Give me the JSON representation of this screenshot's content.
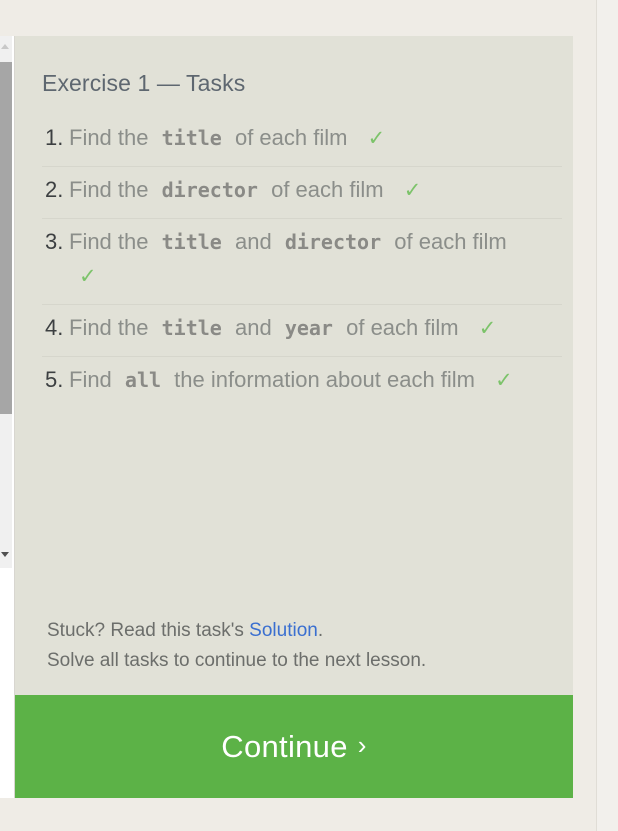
{
  "panel": {
    "title": "Exercise 1 — Tasks"
  },
  "tasks": [
    {
      "num": "1.",
      "pre": "Find the",
      "code1": "title",
      "mid": "",
      "code2": "",
      "post": "of each film",
      "check": "✓"
    },
    {
      "num": "2.",
      "pre": "Find the",
      "code1": "director",
      "mid": "",
      "code2": "",
      "post": "of each film",
      "check": "✓"
    },
    {
      "num": "3.",
      "pre": "Find the",
      "code1": "title",
      "mid": "and",
      "code2": "director",
      "post": "of each film",
      "check": "✓"
    },
    {
      "num": "4.",
      "pre": "Find the",
      "code1": "title",
      "mid": "and",
      "code2": "year",
      "post": "of each film",
      "check": "✓"
    },
    {
      "num": "5.",
      "pre": "Find",
      "code1": "all",
      "mid": "",
      "code2": "",
      "post": "the information about each film",
      "check": "✓"
    }
  ],
  "help": {
    "stuck_prefix": "Stuck? Read this task's",
    "solution_link": "Solution",
    "stuck_suffix": ".",
    "continue_note": "Solve all tasks to continue to the next lesson."
  },
  "continue_button": {
    "label": "Continue",
    "chevron": "›"
  },
  "colors": {
    "panel_bg": "#e1e1d7",
    "check": "#7cc36a",
    "link": "#3a6fd0",
    "continue_bg": "#5cb247"
  }
}
